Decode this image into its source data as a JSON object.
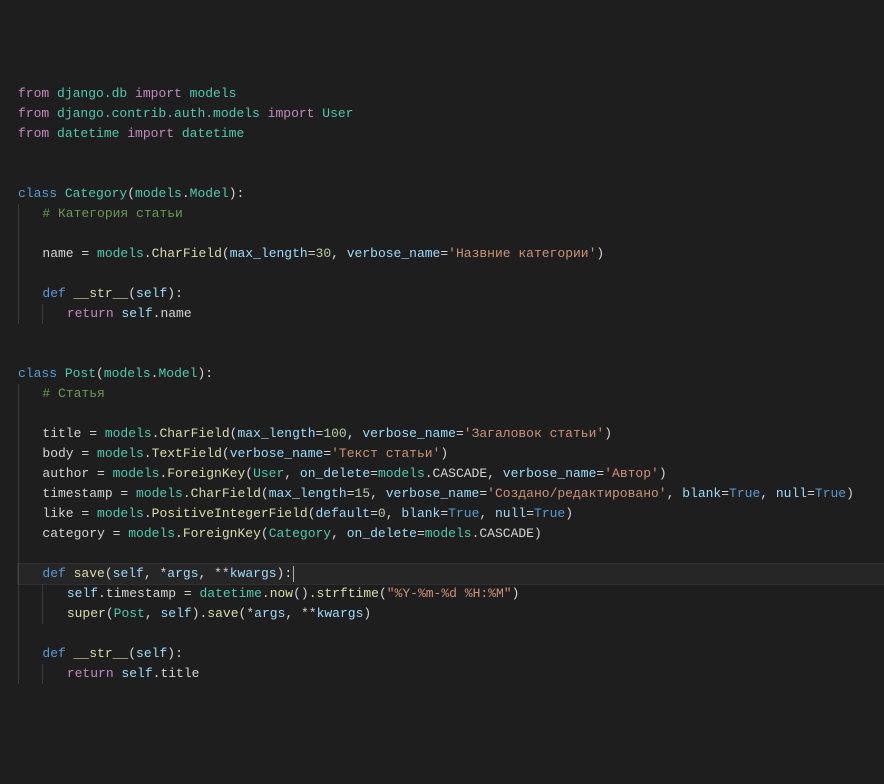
{
  "code": {
    "lines": [
      {
        "tokens": [
          {
            "t": "from ",
            "c": "kw"
          },
          {
            "t": "django.db",
            "c": "ns"
          },
          {
            "t": " import ",
            "c": "kw"
          },
          {
            "t": "models",
            "c": "ns"
          }
        ]
      },
      {
        "tokens": [
          {
            "t": "from ",
            "c": "kw"
          },
          {
            "t": "django.contrib.auth.models",
            "c": "ns"
          },
          {
            "t": " import ",
            "c": "kw"
          },
          {
            "t": "User",
            "c": "ns"
          }
        ]
      },
      {
        "tokens": [
          {
            "t": "from ",
            "c": "kw"
          },
          {
            "t": "datetime",
            "c": "ns"
          },
          {
            "t": " import ",
            "c": "kw"
          },
          {
            "t": "datetime",
            "c": "ns"
          }
        ]
      },
      {
        "tokens": []
      },
      {
        "tokens": []
      },
      {
        "tokens": [
          {
            "t": "class ",
            "c": "def"
          },
          {
            "t": "Category",
            "c": "cls"
          },
          {
            "t": "(",
            "c": "pn"
          },
          {
            "t": "models",
            "c": "ns"
          },
          {
            "t": ".",
            "c": "op"
          },
          {
            "t": "Model",
            "c": "cls"
          },
          {
            "t": "):",
            "c": "pn"
          }
        ]
      },
      {
        "indent": 1,
        "tokens": [
          {
            "t": "# Категория статьи",
            "c": "cmt"
          }
        ]
      },
      {
        "indent": 1,
        "tokens": []
      },
      {
        "indent": 1,
        "tokens": [
          {
            "t": "name ",
            "c": "attr"
          },
          {
            "t": "= ",
            "c": "op"
          },
          {
            "t": "models",
            "c": "ns"
          },
          {
            "t": ".",
            "c": "op"
          },
          {
            "t": "CharField",
            "c": "fn"
          },
          {
            "t": "(",
            "c": "pn"
          },
          {
            "t": "max_length",
            "c": "param"
          },
          {
            "t": "=",
            "c": "op"
          },
          {
            "t": "30",
            "c": "num"
          },
          {
            "t": ", ",
            "c": "pn"
          },
          {
            "t": "verbose_name",
            "c": "param"
          },
          {
            "t": "=",
            "c": "op"
          },
          {
            "t": "'Назвние категории'",
            "c": "str"
          },
          {
            "t": ")",
            "c": "pn"
          }
        ]
      },
      {
        "indent": 1,
        "tokens": []
      },
      {
        "indent": 1,
        "tokens": [
          {
            "t": "def ",
            "c": "def"
          },
          {
            "t": "__str__",
            "c": "fn"
          },
          {
            "t": "(",
            "c": "pn"
          },
          {
            "t": "self",
            "c": "self"
          },
          {
            "t": "):",
            "c": "pn"
          }
        ]
      },
      {
        "indent": 2,
        "tokens": [
          {
            "t": "return ",
            "c": "kw"
          },
          {
            "t": "self",
            "c": "self"
          },
          {
            "t": ".name",
            "c": "attr"
          }
        ]
      },
      {
        "tokens": []
      },
      {
        "tokens": []
      },
      {
        "tokens": [
          {
            "t": "class ",
            "c": "def"
          },
          {
            "t": "Post",
            "c": "cls"
          },
          {
            "t": "(",
            "c": "pn"
          },
          {
            "t": "models",
            "c": "ns"
          },
          {
            "t": ".",
            "c": "op"
          },
          {
            "t": "Model",
            "c": "cls"
          },
          {
            "t": "):",
            "c": "pn"
          }
        ]
      },
      {
        "indent": 1,
        "tokens": [
          {
            "t": "# Статья",
            "c": "cmt"
          }
        ]
      },
      {
        "indent": 1,
        "tokens": []
      },
      {
        "indent": 1,
        "tokens": [
          {
            "t": "title ",
            "c": "attr"
          },
          {
            "t": "= ",
            "c": "op"
          },
          {
            "t": "models",
            "c": "ns"
          },
          {
            "t": ".",
            "c": "op"
          },
          {
            "t": "CharField",
            "c": "fn"
          },
          {
            "t": "(",
            "c": "pn"
          },
          {
            "t": "max_length",
            "c": "param"
          },
          {
            "t": "=",
            "c": "op"
          },
          {
            "t": "100",
            "c": "num"
          },
          {
            "t": ", ",
            "c": "pn"
          },
          {
            "t": "verbose_name",
            "c": "param"
          },
          {
            "t": "=",
            "c": "op"
          },
          {
            "t": "'Загаловок статьи'",
            "c": "str"
          },
          {
            "t": ")",
            "c": "pn"
          }
        ]
      },
      {
        "indent": 1,
        "tokens": [
          {
            "t": "body ",
            "c": "attr"
          },
          {
            "t": "= ",
            "c": "op"
          },
          {
            "t": "models",
            "c": "ns"
          },
          {
            "t": ".",
            "c": "op"
          },
          {
            "t": "TextField",
            "c": "fn"
          },
          {
            "t": "(",
            "c": "pn"
          },
          {
            "t": "verbose_name",
            "c": "param"
          },
          {
            "t": "=",
            "c": "op"
          },
          {
            "t": "'Текст статьи'",
            "c": "str"
          },
          {
            "t": ")",
            "c": "pn"
          }
        ]
      },
      {
        "indent": 1,
        "tokens": [
          {
            "t": "author ",
            "c": "attr"
          },
          {
            "t": "= ",
            "c": "op"
          },
          {
            "t": "models",
            "c": "ns"
          },
          {
            "t": ".",
            "c": "op"
          },
          {
            "t": "ForeignKey",
            "c": "fn"
          },
          {
            "t": "(",
            "c": "pn"
          },
          {
            "t": "User",
            "c": "cls"
          },
          {
            "t": ", ",
            "c": "pn"
          },
          {
            "t": "on_delete",
            "c": "param"
          },
          {
            "t": "=",
            "c": "op"
          },
          {
            "t": "models",
            "c": "ns"
          },
          {
            "t": ".CASCADE",
            "c": "attr"
          },
          {
            "t": ", ",
            "c": "pn"
          },
          {
            "t": "verbose_name",
            "c": "param"
          },
          {
            "t": "=",
            "c": "op"
          },
          {
            "t": "'Автор'",
            "c": "str"
          },
          {
            "t": ")",
            "c": "pn"
          }
        ]
      },
      {
        "indent": 1,
        "tokens": [
          {
            "t": "timestamp ",
            "c": "attr"
          },
          {
            "t": "= ",
            "c": "op"
          },
          {
            "t": "models",
            "c": "ns"
          },
          {
            "t": ".",
            "c": "op"
          },
          {
            "t": "CharField",
            "c": "fn"
          },
          {
            "t": "(",
            "c": "pn"
          },
          {
            "t": "max_length",
            "c": "param"
          },
          {
            "t": "=",
            "c": "op"
          },
          {
            "t": "15",
            "c": "num"
          },
          {
            "t": ", ",
            "c": "pn"
          },
          {
            "t": "verbose_name",
            "c": "param"
          },
          {
            "t": "=",
            "c": "op"
          },
          {
            "t": "'Создано/редактировано'",
            "c": "str"
          },
          {
            "t": ", ",
            "c": "pn"
          },
          {
            "t": "blank",
            "c": "param"
          },
          {
            "t": "=",
            "c": "op"
          },
          {
            "t": "True",
            "c": "bool"
          },
          {
            "t": ", ",
            "c": "pn"
          },
          {
            "t": "null",
            "c": "param"
          },
          {
            "t": "=",
            "c": "op"
          },
          {
            "t": "True",
            "c": "bool"
          },
          {
            "t": ")",
            "c": "pn"
          }
        ]
      },
      {
        "indent": 1,
        "tokens": [
          {
            "t": "like ",
            "c": "attr"
          },
          {
            "t": "= ",
            "c": "op"
          },
          {
            "t": "models",
            "c": "ns"
          },
          {
            "t": ".",
            "c": "op"
          },
          {
            "t": "PositiveIntegerField",
            "c": "fn"
          },
          {
            "t": "(",
            "c": "pn"
          },
          {
            "t": "default",
            "c": "param"
          },
          {
            "t": "=",
            "c": "op"
          },
          {
            "t": "0",
            "c": "num"
          },
          {
            "t": ", ",
            "c": "pn"
          },
          {
            "t": "blank",
            "c": "param"
          },
          {
            "t": "=",
            "c": "op"
          },
          {
            "t": "True",
            "c": "bool"
          },
          {
            "t": ", ",
            "c": "pn"
          },
          {
            "t": "null",
            "c": "param"
          },
          {
            "t": "=",
            "c": "op"
          },
          {
            "t": "True",
            "c": "bool"
          },
          {
            "t": ")",
            "c": "pn"
          }
        ]
      },
      {
        "indent": 1,
        "tokens": [
          {
            "t": "category ",
            "c": "attr"
          },
          {
            "t": "= ",
            "c": "op"
          },
          {
            "t": "models",
            "c": "ns"
          },
          {
            "t": ".",
            "c": "op"
          },
          {
            "t": "ForeignKey",
            "c": "fn"
          },
          {
            "t": "(",
            "c": "pn"
          },
          {
            "t": "Category",
            "c": "cls"
          },
          {
            "t": ", ",
            "c": "pn"
          },
          {
            "t": "on_delete",
            "c": "param"
          },
          {
            "t": "=",
            "c": "op"
          },
          {
            "t": "models",
            "c": "ns"
          },
          {
            "t": ".CASCADE",
            "c": "attr"
          },
          {
            "t": ")",
            "c": "pn"
          }
        ]
      },
      {
        "indent": 1,
        "tokens": []
      },
      {
        "indent": 1,
        "current": true,
        "cursor": true,
        "tokens": [
          {
            "t": "def ",
            "c": "def"
          },
          {
            "t": "save",
            "c": "fn"
          },
          {
            "t": "(",
            "c": "pn"
          },
          {
            "t": "self",
            "c": "self"
          },
          {
            "t": ", ",
            "c": "pn"
          },
          {
            "t": "*",
            "c": "op"
          },
          {
            "t": "args",
            "c": "param"
          },
          {
            "t": ", ",
            "c": "pn"
          },
          {
            "t": "**",
            "c": "op"
          },
          {
            "t": "kwargs",
            "c": "param"
          },
          {
            "t": "):",
            "c": "pn"
          }
        ]
      },
      {
        "indent": 2,
        "tokens": [
          {
            "t": "self",
            "c": "self"
          },
          {
            "t": ".timestamp ",
            "c": "attr"
          },
          {
            "t": "= ",
            "c": "op"
          },
          {
            "t": "datetime",
            "c": "ns"
          },
          {
            "t": ".",
            "c": "op"
          },
          {
            "t": "now",
            "c": "fn"
          },
          {
            "t": "().",
            "c": "pn"
          },
          {
            "t": "strftime",
            "c": "fn"
          },
          {
            "t": "(",
            "c": "pn"
          },
          {
            "t": "\"%Y-%m-%d %H:%M\"",
            "c": "str"
          },
          {
            "t": ")",
            "c": "pn"
          }
        ]
      },
      {
        "indent": 2,
        "tokens": [
          {
            "t": "super",
            "c": "fn"
          },
          {
            "t": "(",
            "c": "pn"
          },
          {
            "t": "Post",
            "c": "cls"
          },
          {
            "t": ", ",
            "c": "pn"
          },
          {
            "t": "self",
            "c": "self"
          },
          {
            "t": ").",
            "c": "pn"
          },
          {
            "t": "save",
            "c": "fn"
          },
          {
            "t": "(",
            "c": "pn"
          },
          {
            "t": "*",
            "c": "op"
          },
          {
            "t": "args",
            "c": "param"
          },
          {
            "t": ", ",
            "c": "pn"
          },
          {
            "t": "**",
            "c": "op"
          },
          {
            "t": "kwargs",
            "c": "param"
          },
          {
            "t": ")",
            "c": "pn"
          }
        ]
      },
      {
        "indent": 1,
        "tokens": []
      },
      {
        "indent": 1,
        "tokens": [
          {
            "t": "def ",
            "c": "def"
          },
          {
            "t": "__str__",
            "c": "fn"
          },
          {
            "t": "(",
            "c": "pn"
          },
          {
            "t": "self",
            "c": "self"
          },
          {
            "t": "):",
            "c": "pn"
          }
        ]
      },
      {
        "indent": 2,
        "tokens": [
          {
            "t": "return ",
            "c": "kw"
          },
          {
            "t": "self",
            "c": "self"
          },
          {
            "t": ".title",
            "c": "attr"
          }
        ]
      }
    ]
  }
}
